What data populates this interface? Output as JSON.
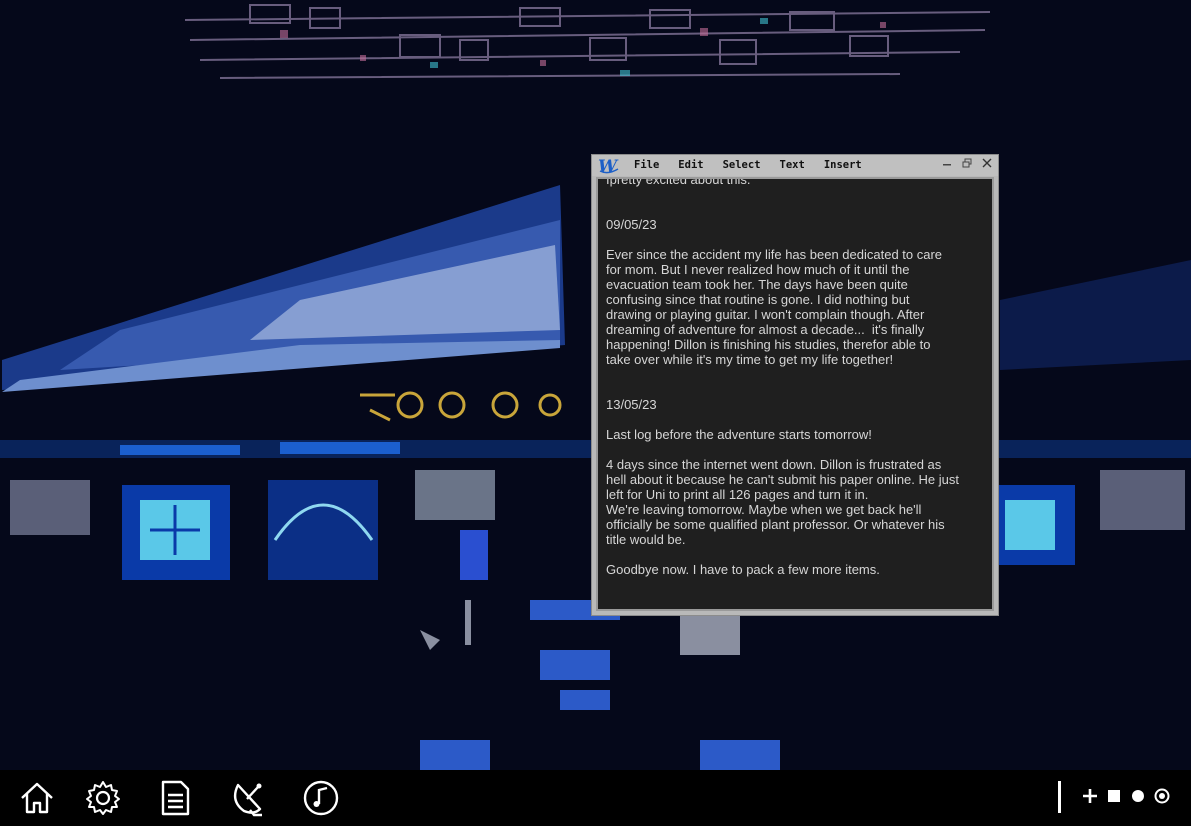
{
  "wallpaper": {
    "description_icon": "airplane-cockpit-wallpaper"
  },
  "editor": {
    "app_icon": "w-logo-icon",
    "menu": [
      "File",
      "Edit",
      "Select",
      "Text",
      "Insert"
    ],
    "controls": [
      "minimize-icon",
      "restore-icon",
      "close-icon"
    ],
    "document_text": "Ipretty excited about this.\n\n\n09/05/23\n\nEver since the accident my life has been dedicated to care\nfor mom. But I never realized how much of it until the\nevacuation team took her. The days have been quite\nconfusing since that routine is gone. I did nothing but\ndrawing or playing guitar. I won't complain though. After\ndreaming of adventure for almost a decade...  it's finally\nhappening! Dillon is finishing his studies, therefor able to\ntake over while it's my time to get my life together!\n\n\n13/05/23\n\nLast log before the adventure starts tomorrow!\n\n4 days since the internet went down. Dillon is frustrated as\nhell about it because he can't submit his paper online. He just\nleft for Uni to print all 126 pages and turn it in.\nWe're leaving tomorrow. Maybe when we get back he'll\nofficially be some qualified plant professor. Or whatever his\ntitle would be.\n\nGoodbye now. I have to pack a few more items."
  },
  "taskbar": {
    "apps": [
      "home-icon",
      "settings-gear-icon",
      "document-icon",
      "satellite-dish-icon",
      "music-note-icon"
    ],
    "status": [
      "plus-icon",
      "square-icon",
      "dot-icon",
      "target-icon"
    ]
  },
  "colors": {
    "taskbar_bg": "#000000",
    "document_bg": "#1f1f1f",
    "document_text": "#d6d6d6",
    "window_chrome": "#c0c0c0"
  }
}
